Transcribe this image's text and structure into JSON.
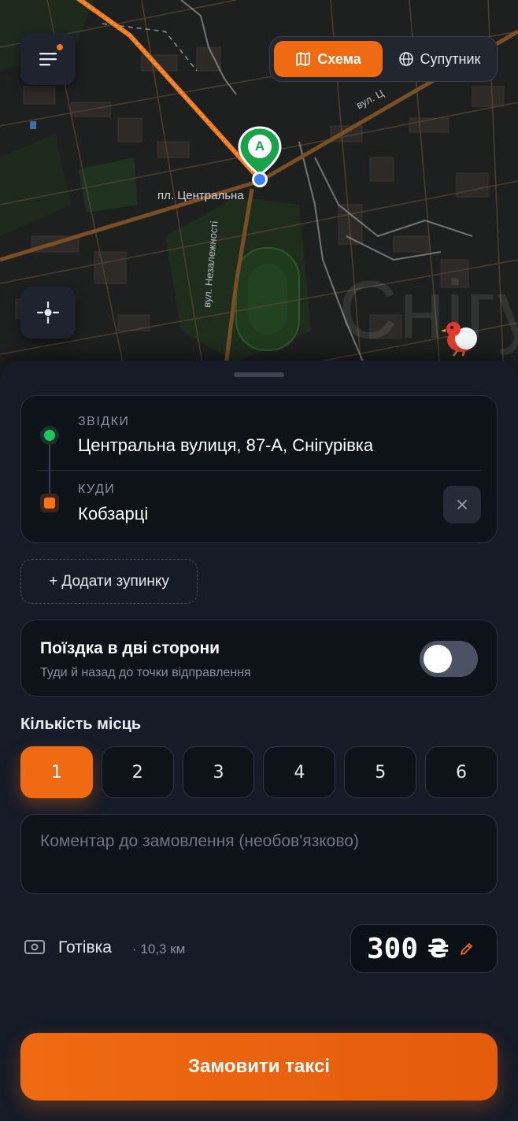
{
  "map": {
    "type_toggle": {
      "scheme_label": "Схема",
      "satellite_label": "Супутник",
      "selected": "Схема"
    },
    "place_label": "пл. Центральна",
    "watermark_text": "Снігу",
    "street_label_1": "вул. Незалежності",
    "street_label_2": "вул. Ц",
    "pin_letter": "A",
    "accent_color": "#ef6a13",
    "pin_color": "#16a34a"
  },
  "route": {
    "from_label": "ЗВІДКИ",
    "from_value": "Центральна вулиця, 87-А, Снігурівка",
    "to_label": "КУДИ",
    "to_value": "Кобзарці"
  },
  "add_stop_label": "+ Додати зупинку",
  "round_trip": {
    "title": "Поїздка в дві сторони",
    "subtitle": "Туди й назад до точки відправлення",
    "enabled": false
  },
  "seats": {
    "title": "Кількість місць",
    "options": [
      "1",
      "2",
      "3",
      "4",
      "5",
      "6"
    ],
    "selected": "1"
  },
  "comment": {
    "placeholder": "Коментар до замовлення (необов'язково)",
    "value": ""
  },
  "payment": {
    "method": "Готівка",
    "distance": "· 10,3 км",
    "price": "300",
    "currency": "₴"
  },
  "order_button_label": "Замовити таксі"
}
